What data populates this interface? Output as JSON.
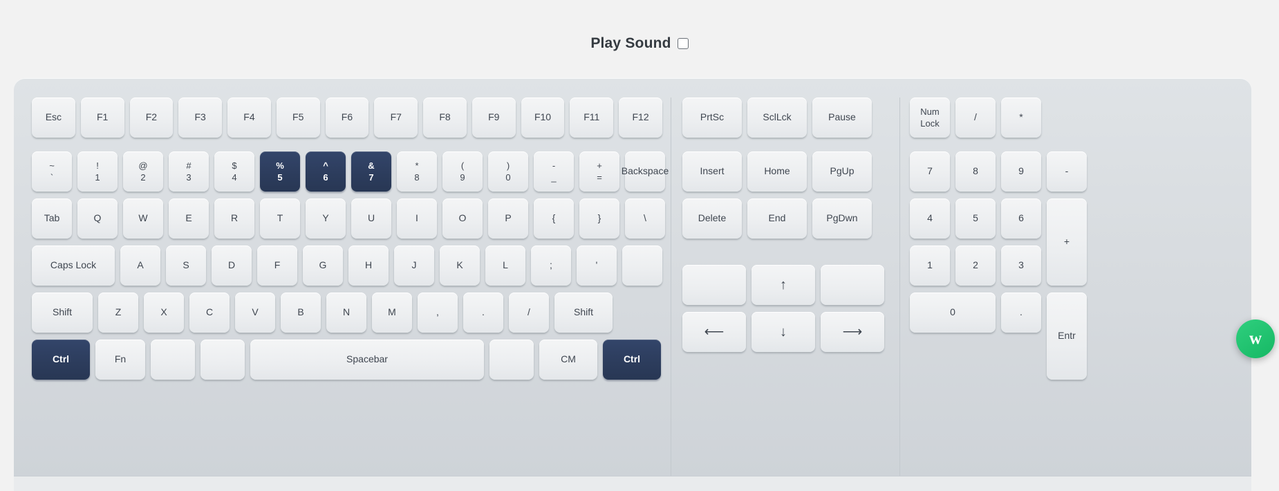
{
  "header": {
    "title": "Play Sound",
    "checkbox_name": "play-sound-checkbox",
    "checked": false
  },
  "colors": {
    "key_face": "#eceef0",
    "key_text": "#3f4650",
    "active_key": "#2c3c5c",
    "active_key_text": "#ffffff",
    "keyboard_body": "#d6dade",
    "page_background": "#f2f2f2",
    "widget_green": "#16b864"
  },
  "floating_widget": {
    "label": "w"
  },
  "keyboard": {
    "main": {
      "function_row": [
        {
          "label": "Esc",
          "active": false
        },
        {
          "label": "F1",
          "active": false
        },
        {
          "label": "F2",
          "active": false
        },
        {
          "label": "F3",
          "active": false
        },
        {
          "label": "F4",
          "active": false
        },
        {
          "label": "F5",
          "active": false
        },
        {
          "label": "F6",
          "active": false
        },
        {
          "label": "F7",
          "active": false
        },
        {
          "label": "F8",
          "active": false
        },
        {
          "label": "F9",
          "active": false
        },
        {
          "label": "F10",
          "active": false
        },
        {
          "label": "F11",
          "active": false
        },
        {
          "label": "F12",
          "active": false
        }
      ],
      "number_row": [
        {
          "top": "~",
          "bottom": "`",
          "active": false
        },
        {
          "top": "!",
          "bottom": "1",
          "active": false
        },
        {
          "top": "@",
          "bottom": "2",
          "active": false
        },
        {
          "top": "#",
          "bottom": "3",
          "active": false
        },
        {
          "top": "$",
          "bottom": "4",
          "active": false
        },
        {
          "top": "%",
          "bottom": "5",
          "active": true
        },
        {
          "top": "^",
          "bottom": "6",
          "active": true
        },
        {
          "top": "&",
          "bottom": "7",
          "active": true
        },
        {
          "top": "*",
          "bottom": "8",
          "active": false
        },
        {
          "top": "(",
          "bottom": "9",
          "active": false
        },
        {
          "top": ")",
          "bottom": "0",
          "active": false
        },
        {
          "top": "-",
          "bottom": "_",
          "active": false
        },
        {
          "top": "+",
          "bottom": "=",
          "active": false
        }
      ],
      "backspace": {
        "label": "Backspace",
        "active": false
      },
      "tab": {
        "label": "Tab",
        "active": false
      },
      "tab_row": [
        {
          "label": "Q",
          "active": false
        },
        {
          "label": "W",
          "active": false
        },
        {
          "label": "E",
          "active": false
        },
        {
          "label": "R",
          "active": false
        },
        {
          "label": "T",
          "active": false
        },
        {
          "label": "Y",
          "active": false
        },
        {
          "label": "U",
          "active": false
        },
        {
          "label": "I",
          "active": false
        },
        {
          "label": "O",
          "active": false
        },
        {
          "label": "P",
          "active": false
        },
        {
          "label": "{",
          "active": false
        },
        {
          "label": "}",
          "active": false
        },
        {
          "label": "\\",
          "active": false
        }
      ],
      "caps": {
        "label": "Caps Lock",
        "active": false
      },
      "home_row": [
        {
          "label": "A",
          "active": false
        },
        {
          "label": "S",
          "active": false
        },
        {
          "label": "D",
          "active": false
        },
        {
          "label": "F",
          "active": false
        },
        {
          "label": "G",
          "active": false
        },
        {
          "label": "H",
          "active": false
        },
        {
          "label": "J",
          "active": false
        },
        {
          "label": "K",
          "active": false
        },
        {
          "label": "L",
          "active": false
        },
        {
          "label": ";",
          "active": false
        },
        {
          "label": "'",
          "active": false
        },
        {
          "label": "",
          "active": false
        }
      ],
      "shift_left": {
        "label": "Shift",
        "active": false
      },
      "shift_row": [
        {
          "label": "Z",
          "active": false
        },
        {
          "label": "X",
          "active": false
        },
        {
          "label": "C",
          "active": false
        },
        {
          "label": "V",
          "active": false
        },
        {
          "label": "B",
          "active": false
        },
        {
          "label": "N",
          "active": false
        },
        {
          "label": "M",
          "active": false
        },
        {
          "label": ",",
          "active": false
        },
        {
          "label": ".",
          "active": false
        },
        {
          "label": "/",
          "active": false
        }
      ],
      "shift_right": {
        "label": "Shift",
        "active": false
      },
      "bottom_row": {
        "ctrl_left": {
          "label": "Ctrl",
          "active": true
        },
        "fn": {
          "label": "Fn",
          "active": false
        },
        "mod1": {
          "label": "",
          "active": false
        },
        "mod2": {
          "label": "",
          "active": false
        },
        "spacebar": {
          "label": "Spacebar",
          "active": false
        },
        "mod3": {
          "label": "",
          "active": false
        },
        "cm": {
          "label": "CM",
          "active": false
        },
        "ctrl_right": {
          "label": "Ctrl",
          "active": true
        }
      }
    },
    "nav": {
      "row1": [
        {
          "label": "PrtSc",
          "active": false
        },
        {
          "label": "SclLck",
          "active": false
        },
        {
          "label": "Pause",
          "active": false
        }
      ],
      "row2": [
        {
          "label": "Insert",
          "active": false
        },
        {
          "label": "Home",
          "active": false
        },
        {
          "label": "PgUp",
          "active": false
        }
      ],
      "row3": [
        {
          "label": "Delete",
          "active": false
        },
        {
          "label": "End",
          "active": false
        },
        {
          "label": "PgDwn",
          "active": false
        }
      ],
      "arrows": {
        "blank_left": {
          "label": "",
          "active": false
        },
        "up": {
          "label": "↑",
          "active": false
        },
        "blank_right": {
          "label": "",
          "active": false
        },
        "left": {
          "label": "⟵",
          "active": false
        },
        "down": {
          "label": "↓",
          "active": false
        },
        "right": {
          "label": "⟶",
          "active": false
        }
      }
    },
    "numpad": {
      "row1": [
        {
          "top": "Num",
          "bottom": "Lock",
          "active": false
        },
        {
          "label": "/",
          "active": false
        },
        {
          "label": "*",
          "active": false
        },
        {
          "label": "-",
          "active": false
        }
      ],
      "row2": [
        {
          "label": "7",
          "active": false
        },
        {
          "label": "8",
          "active": false
        },
        {
          "label": "9",
          "active": false
        }
      ],
      "plus": {
        "label": "+",
        "active": false
      },
      "row3": [
        {
          "label": "4",
          "active": false
        },
        {
          "label": "5",
          "active": false
        },
        {
          "label": "6",
          "active": false
        }
      ],
      "row4": [
        {
          "label": "1",
          "active": false
        },
        {
          "label": "2",
          "active": false
        },
        {
          "label": "3",
          "active": false
        }
      ],
      "enter": {
        "label": "Entr",
        "active": false
      },
      "zero": {
        "label": "0",
        "active": false
      },
      "dot": {
        "label": ".",
        "active": false
      }
    }
  }
}
